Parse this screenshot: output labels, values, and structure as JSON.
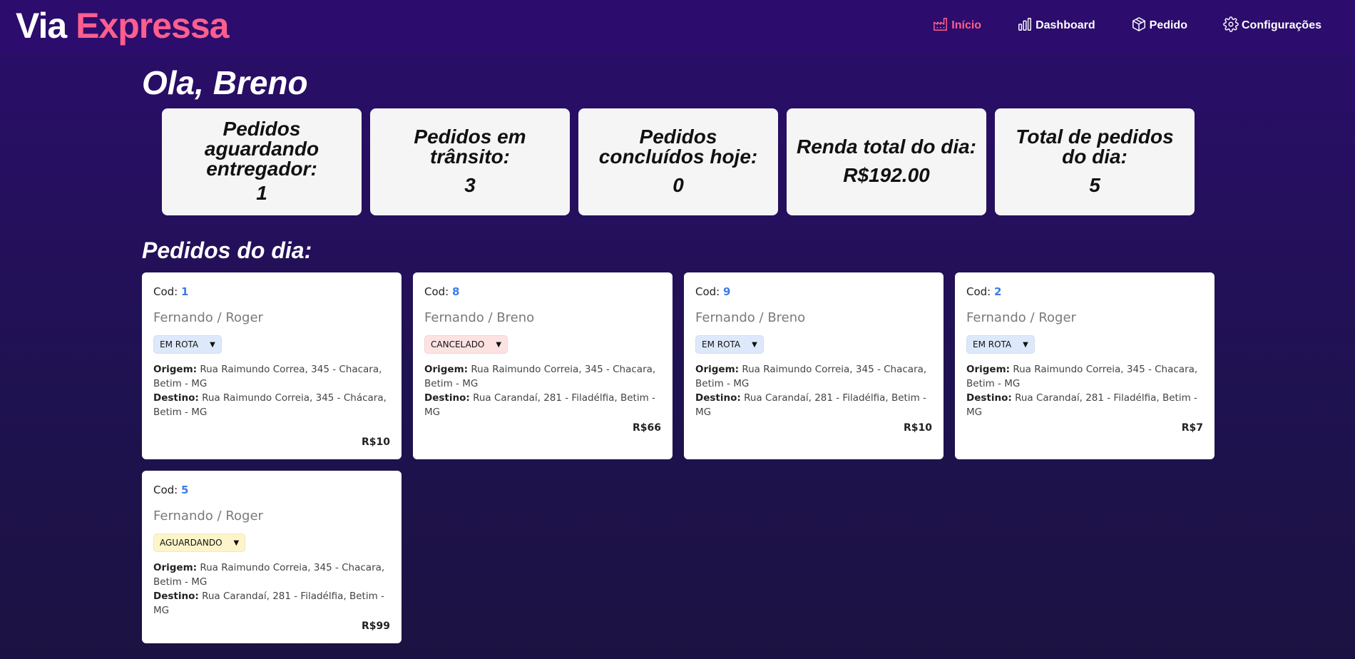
{
  "brand": {
    "part1": "Via",
    "part2": "Expressa"
  },
  "nav": [
    {
      "label": "Início",
      "icon": "factory-icon",
      "active": true
    },
    {
      "label": "Dashboard",
      "icon": "bar-chart-icon",
      "active": false
    },
    {
      "label": "Pedido",
      "icon": "box-icon",
      "active": false
    },
    {
      "label": "Configurações",
      "icon": "gear-icon",
      "active": false
    }
  ],
  "greeting": "Ola, Breno",
  "stats": [
    {
      "label": "Pedidos aguardando entregador:",
      "value": "1"
    },
    {
      "label": "Pedidos em trânsito:",
      "value": "3"
    },
    {
      "label": "Pedidos concluídos hoje:",
      "value": "0"
    },
    {
      "label": "Renda total do dia:",
      "value": "R$192.00"
    },
    {
      "label": "Total de pedidos do dia:",
      "value": "5"
    }
  ],
  "orders_title": "Pedidos do dia:",
  "labels": {
    "cod": "Cod:",
    "origem": "Origem:",
    "destino": "Destino:"
  },
  "orders": [
    {
      "cod": "1",
      "names": "Fernando  /  Roger",
      "status": "EM ROTA",
      "origem": "Rua Raimundo Correa, 345 - Chacara, Betim - MG",
      "destino": "Rua Raimundo Correia, 345 - Chácara, Betim - MG",
      "price": "R$10"
    },
    {
      "cod": "8",
      "names": "Fernando  /  Breno",
      "status": "CANCELADO",
      "origem": "Rua Raimundo Correia, 345 - Chacara, Betim - MG",
      "destino": "Rua Carandaí, 281 - Filadélfia, Betim - MG",
      "price": "R$66"
    },
    {
      "cod": "9",
      "names": "Fernando  /  Breno",
      "status": "EM ROTA",
      "origem": "Rua Raimundo Correia, 345 - Chacara, Betim - MG",
      "destino": "Rua Carandaí, 281 - Filadélfia, Betim - MG",
      "price": "R$10"
    },
    {
      "cod": "2",
      "names": "Fernando  /  Roger",
      "status": "EM ROTA",
      "origem": "Rua Raimundo Correia, 345 - Chacara, Betim - MG",
      "destino": "Rua Carandaí, 281 - Filadélfia, Betim - MG",
      "price": "R$7"
    },
    {
      "cod": "5",
      "names": "Fernando  /  Roger",
      "status": "AGUARDANDO",
      "origem": "Rua Raimundo Correia, 345 - Chacara, Betim - MG",
      "destino": "Rua Carandaí, 281 - Filadélfia, Betim - MG",
      "price": "R$99"
    }
  ],
  "colors": {
    "header_bg": "#2c0c6c",
    "accent_pink": "#ff5e8e",
    "code_blue": "#3b7ce6",
    "status_em_rota": "#dde9fb",
    "status_cancelado": "#fde2e2",
    "status_aguardando": "#fdf5c9"
  }
}
